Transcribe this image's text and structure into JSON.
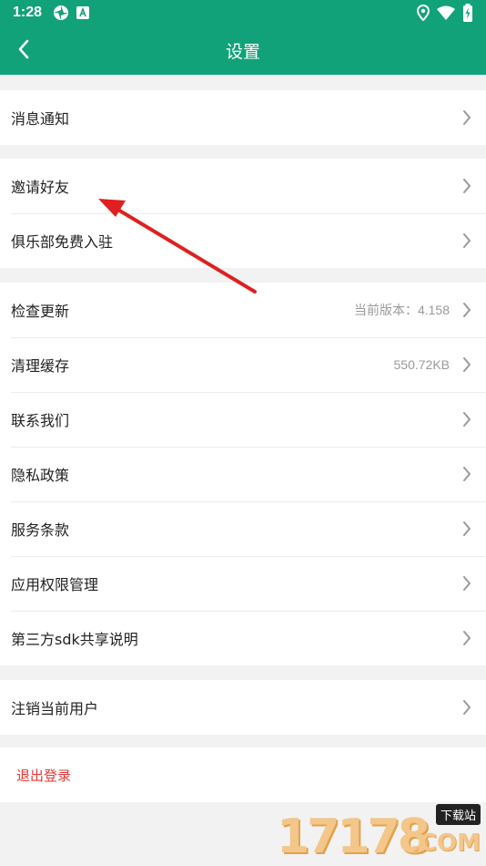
{
  "status_bar": {
    "time": "1:28",
    "left_icons": [
      "pinwheel-icon",
      "app-notification-icon"
    ],
    "right_icons": [
      "location-icon",
      "wifi-icon",
      "battery-charging-icon"
    ]
  },
  "header": {
    "title": "设置",
    "back_icon": "chevron-left-icon",
    "background": "#12a27a"
  },
  "groups": [
    {
      "items": [
        {
          "label": "消息通知"
        }
      ]
    },
    {
      "items": [
        {
          "label": "邀请好友"
        },
        {
          "label": "俱乐部免费入驻"
        }
      ]
    },
    {
      "items": [
        {
          "label": "检查更新",
          "value": "当前版本：4.158"
        },
        {
          "label": "清理缓存",
          "value": "550.72KB"
        },
        {
          "label": "联系我们"
        },
        {
          "label": "隐私政策"
        },
        {
          "label": "服务条款"
        },
        {
          "label": "应用权限管理"
        },
        {
          "label": "第三方sdk共享说明"
        }
      ]
    },
    {
      "items": [
        {
          "label": "注销当前用户"
        }
      ]
    }
  ],
  "logout": {
    "label": "退出登录",
    "color": "#e53935"
  },
  "annotation": {
    "color": "#e02020"
  },
  "watermark": {
    "number": "17178",
    "site": "下载站",
    "domain": ".COM"
  }
}
